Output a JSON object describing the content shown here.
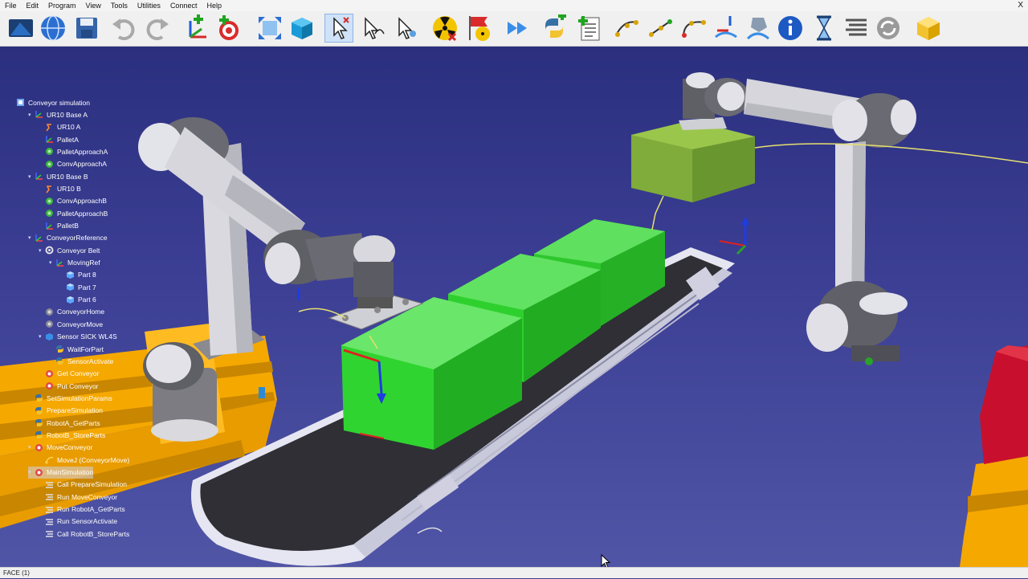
{
  "menu": [
    "File",
    "Edit",
    "Program",
    "View",
    "Tools",
    "Utilities",
    "Connect",
    "Help"
  ],
  "window_close": "X",
  "toolbar_icons": [
    "load-station-icon",
    "open-library-icon",
    "save-icon",
    "undo-icon",
    "redo-icon",
    "add-reference-frame-icon",
    "add-target-icon",
    "fit-all-icon",
    "isometric-view-icon",
    "select-tool-icon",
    "select-curve-icon",
    "select-point-icon",
    "check-collisions-icon",
    "stop-collisions-icon",
    "fast-simulation-icon",
    "add-python-program-icon",
    "add-program-icon",
    "move-joint-icon",
    "move-linear-icon",
    "move-circular-icon",
    "follow-curve-icon",
    "machining-project-icon",
    "info-icon",
    "pause-icon",
    "instruction-list-icon",
    "update-program-icon",
    "generate-program-icon"
  ],
  "tree": {
    "root": "Conveyor simulation",
    "nodes": [
      {
        "label": "UR10 Base A",
        "level": 1,
        "icon": "reference-frame-icon"
      },
      {
        "label": "UR10 A",
        "level": 2,
        "icon": "robot-icon"
      },
      {
        "label": "PalletA",
        "level": 2,
        "icon": "reference-frame-icon"
      },
      {
        "label": "PalletApproachA",
        "level": 2,
        "icon": "target-icon"
      },
      {
        "label": "ConvApproachA",
        "level": 2,
        "icon": "target-icon"
      },
      {
        "label": "UR10 Base B",
        "level": 1,
        "icon": "reference-frame-icon"
      },
      {
        "label": "UR10 B",
        "level": 2,
        "icon": "robot-icon"
      },
      {
        "label": "ConvApproachB",
        "level": 2,
        "icon": "target-icon"
      },
      {
        "label": "PalletApproachB",
        "level": 2,
        "icon": "target-icon"
      },
      {
        "label": "PalletB",
        "level": 2,
        "icon": "reference-frame-icon"
      },
      {
        "label": "ConveyorReference",
        "level": 1,
        "icon": "reference-frame-icon"
      },
      {
        "label": "Conveyor Belt",
        "level": 2,
        "icon": "mechanism-icon"
      },
      {
        "label": "MovingRef",
        "level": 3,
        "icon": "reference-frame-icon"
      },
      {
        "label": "Part 8",
        "level": 4,
        "icon": "part-icon"
      },
      {
        "label": "Part 7",
        "level": 4,
        "icon": "part-icon"
      },
      {
        "label": "Part 6",
        "level": 4,
        "icon": "part-icon"
      },
      {
        "label": "ConveyorHome",
        "level": 2,
        "icon": "target-joint-icon"
      },
      {
        "label": "ConveyorMove",
        "level": 2,
        "icon": "target-joint-icon"
      },
      {
        "label": "Sensor SICK WL4S",
        "level": 2,
        "icon": "sensor-icon"
      },
      {
        "label": "WaitForPart",
        "level": 3,
        "icon": "python-icon"
      },
      {
        "label": "SensorActivate",
        "level": 3,
        "icon": "python-icon"
      },
      {
        "label": "Get Conveyor",
        "level": 2,
        "icon": "program-icon"
      },
      {
        "label": "Put Conveyor",
        "level": 2,
        "icon": "program-icon"
      },
      {
        "label": "SetSimulationParams",
        "level": 1,
        "icon": "python-icon"
      },
      {
        "label": "PrepareSimulation",
        "level": 1,
        "icon": "python-icon"
      },
      {
        "label": "RobotA_GetParts",
        "level": 1,
        "icon": "python-icon"
      },
      {
        "label": "RobotB_StoreParts",
        "level": 1,
        "icon": "python-icon"
      },
      {
        "label": "MoveConveyor",
        "level": 1,
        "icon": "program-icon"
      },
      {
        "label": "MoveJ (ConveyorMove)",
        "level": 2,
        "icon": "movej-icon"
      },
      {
        "label": "MainSimulation",
        "level": 1,
        "icon": "program-icon"
      },
      {
        "label": "Call PrepareSimulation",
        "level": 2,
        "icon": "instruction-icon"
      },
      {
        "label": "Run MoveConveyor",
        "level": 2,
        "icon": "instruction-icon"
      },
      {
        "label": "Run RobotA_GetParts",
        "level": 2,
        "icon": "instruction-icon"
      },
      {
        "label": "Run SensorActivate",
        "level": 2,
        "icon": "instruction-icon"
      },
      {
        "label": "Call RobotB_StoreParts",
        "level": 2,
        "icon": "instruction-icon"
      }
    ]
  },
  "status": "FACE (1)",
  "colors": {
    "background_top": "#2b2f7e",
    "background_bottom": "#5055a6",
    "part_green": "#2fd02f",
    "pallet_orange": "#f5a800",
    "conveyor_belt": "#333333",
    "robot_grey": "#9a9a9a"
  }
}
